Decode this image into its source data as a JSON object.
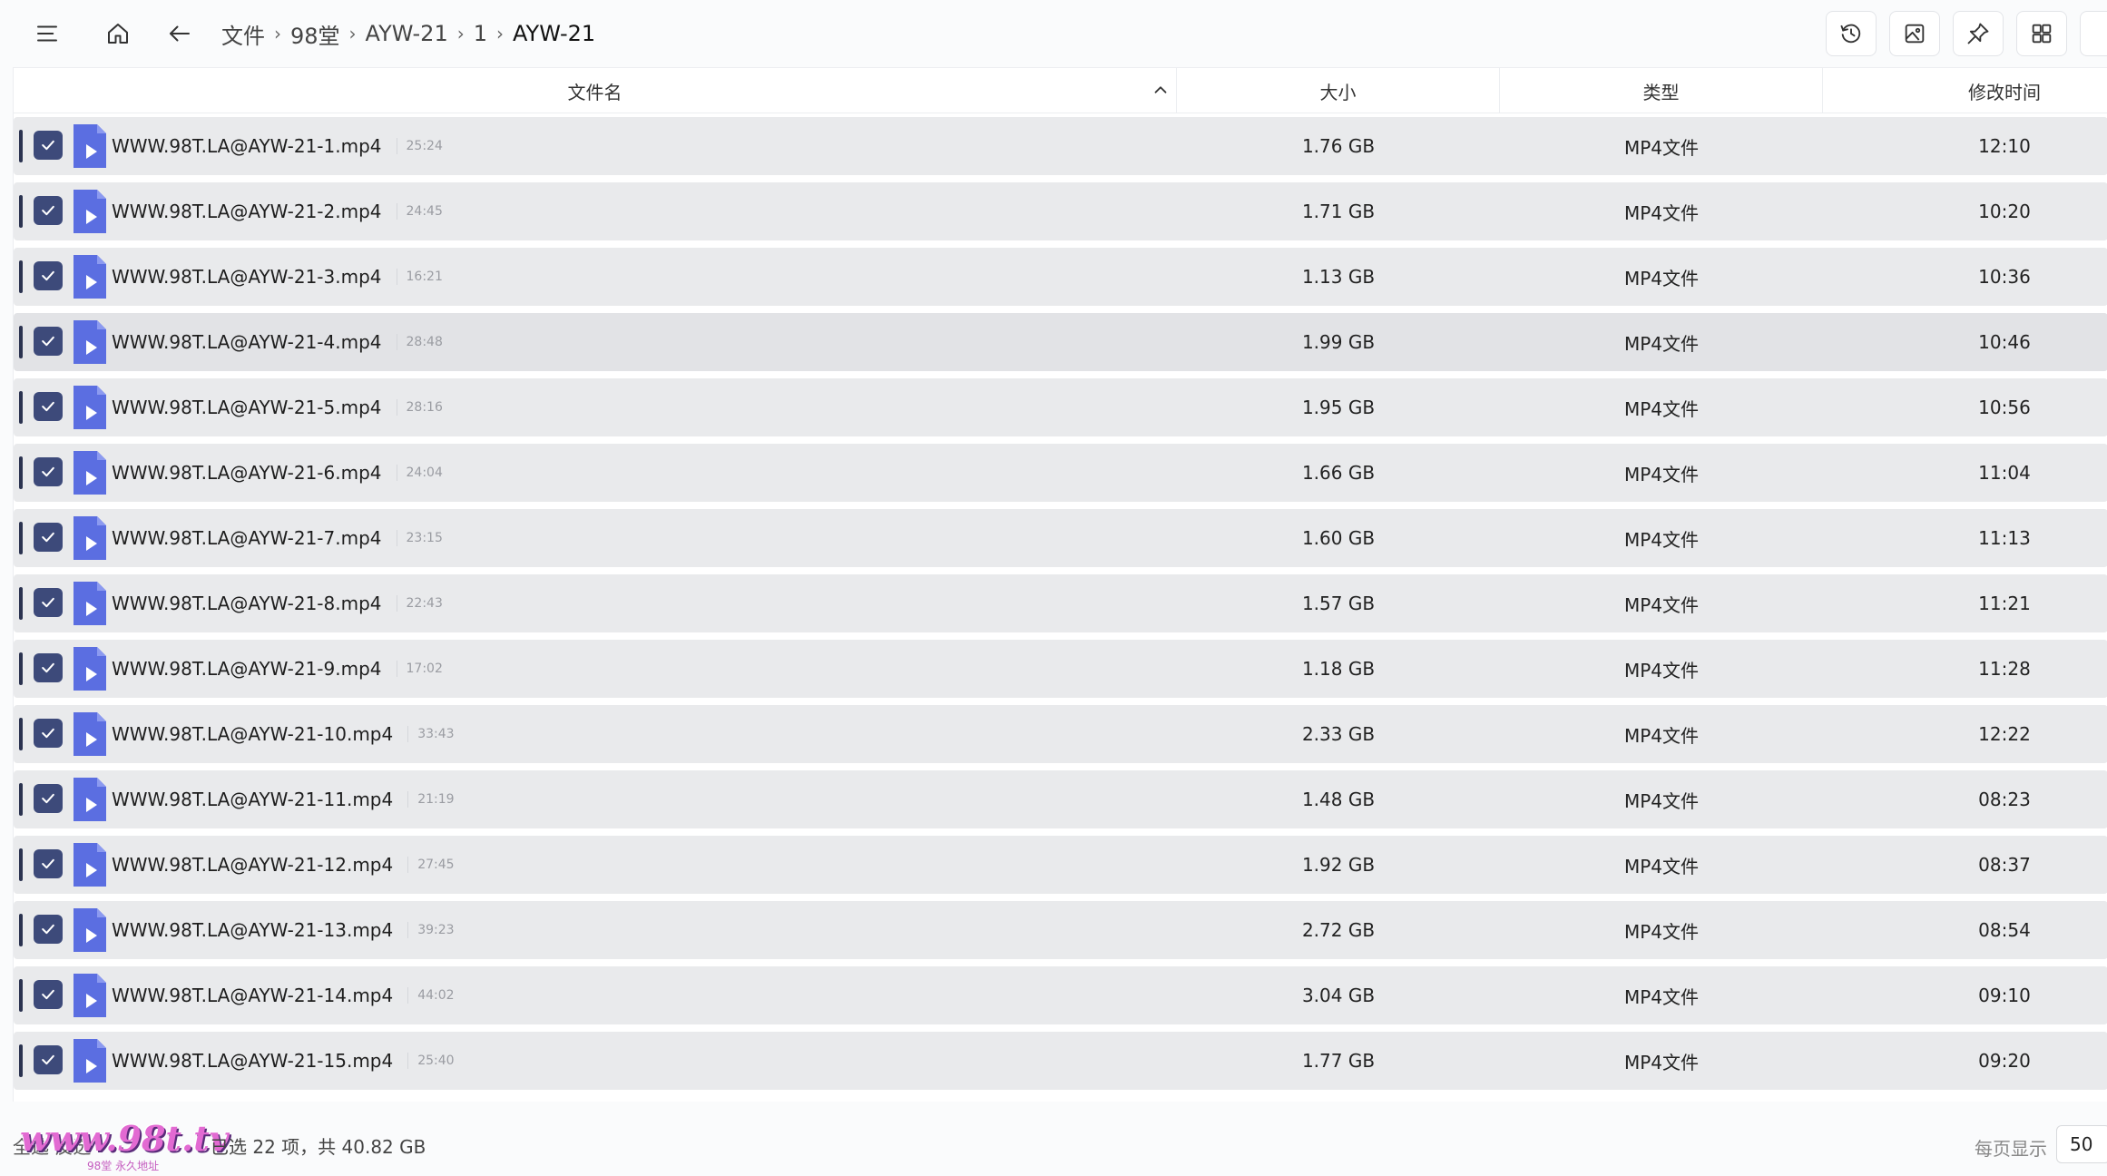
{
  "breadcrumb": [
    "文件",
    "98堂",
    "AYW-21",
    "1",
    "AYW-21"
  ],
  "columns": {
    "name": "文件名",
    "size": "大小",
    "type": "类型",
    "mtime": "修改时间"
  },
  "rows": [
    {
      "name": "WWW.98T.LA@AYW-21-1.mp4",
      "duration": "25:24",
      "size": "1.76 GB",
      "type": "MP4文件",
      "mtime": "12:10"
    },
    {
      "name": "WWW.98T.LA@AYW-21-2.mp4",
      "duration": "24:45",
      "size": "1.71 GB",
      "type": "MP4文件",
      "mtime": "10:20"
    },
    {
      "name": "WWW.98T.LA@AYW-21-3.mp4",
      "duration": "16:21",
      "size": "1.13 GB",
      "type": "MP4文件",
      "mtime": "10:36"
    },
    {
      "name": "WWW.98T.LA@AYW-21-4.mp4",
      "duration": "28:48",
      "size": "1.99 GB",
      "type": "MP4文件",
      "mtime": "10:46"
    },
    {
      "name": "WWW.98T.LA@AYW-21-5.mp4",
      "duration": "28:16",
      "size": "1.95 GB",
      "type": "MP4文件",
      "mtime": "10:56"
    },
    {
      "name": "WWW.98T.LA@AYW-21-6.mp4",
      "duration": "24:04",
      "size": "1.66 GB",
      "type": "MP4文件",
      "mtime": "11:04"
    },
    {
      "name": "WWW.98T.LA@AYW-21-7.mp4",
      "duration": "23:15",
      "size": "1.60 GB",
      "type": "MP4文件",
      "mtime": "11:13"
    },
    {
      "name": "WWW.98T.LA@AYW-21-8.mp4",
      "duration": "22:43",
      "size": "1.57 GB",
      "type": "MP4文件",
      "mtime": "11:21"
    },
    {
      "name": "WWW.98T.LA@AYW-21-9.mp4",
      "duration": "17:02",
      "size": "1.18 GB",
      "type": "MP4文件",
      "mtime": "11:28"
    },
    {
      "name": "WWW.98T.LA@AYW-21-10.mp4",
      "duration": "33:43",
      "size": "2.33 GB",
      "type": "MP4文件",
      "mtime": "12:22"
    },
    {
      "name": "WWW.98T.LA@AYW-21-11.mp4",
      "duration": "21:19",
      "size": "1.48 GB",
      "type": "MP4文件",
      "mtime": "08:23"
    },
    {
      "name": "WWW.98T.LA@AYW-21-12.mp4",
      "duration": "27:45",
      "size": "1.92 GB",
      "type": "MP4文件",
      "mtime": "08:37"
    },
    {
      "name": "WWW.98T.LA@AYW-21-13.mp4",
      "duration": "39:23",
      "size": "2.72 GB",
      "type": "MP4文件",
      "mtime": "08:54"
    },
    {
      "name": "WWW.98T.LA@AYW-21-14.mp4",
      "duration": "44:02",
      "size": "3.04 GB",
      "type": "MP4文件",
      "mtime": "09:10"
    },
    {
      "name": "WWW.98T.LA@AYW-21-15.mp4",
      "duration": "25:40",
      "size": "1.77 GB",
      "type": "MP4文件",
      "mtime": "09:20"
    }
  ],
  "footer": {
    "select_all": "全选  反选",
    "summary": "已选 22 项，共 40.82 GB",
    "per_page_label": "每页显示",
    "per_page_value": "50",
    "watermark": "www.98t.tv",
    "watermark_sub": "98堂 永久地址"
  },
  "colors": {
    "checkbox": "#3d4a7a",
    "file_icon": "#5b6ee1",
    "row_bg": "#e9eaec"
  },
  "icons": {
    "menu": "menu-icon",
    "home": "home-icon",
    "back": "back-arrow-icon",
    "history": "history-icon",
    "image": "image-icon",
    "pin": "pin-icon",
    "grid": "grid-icon",
    "file": "video-file-icon",
    "check": "check-icon"
  }
}
